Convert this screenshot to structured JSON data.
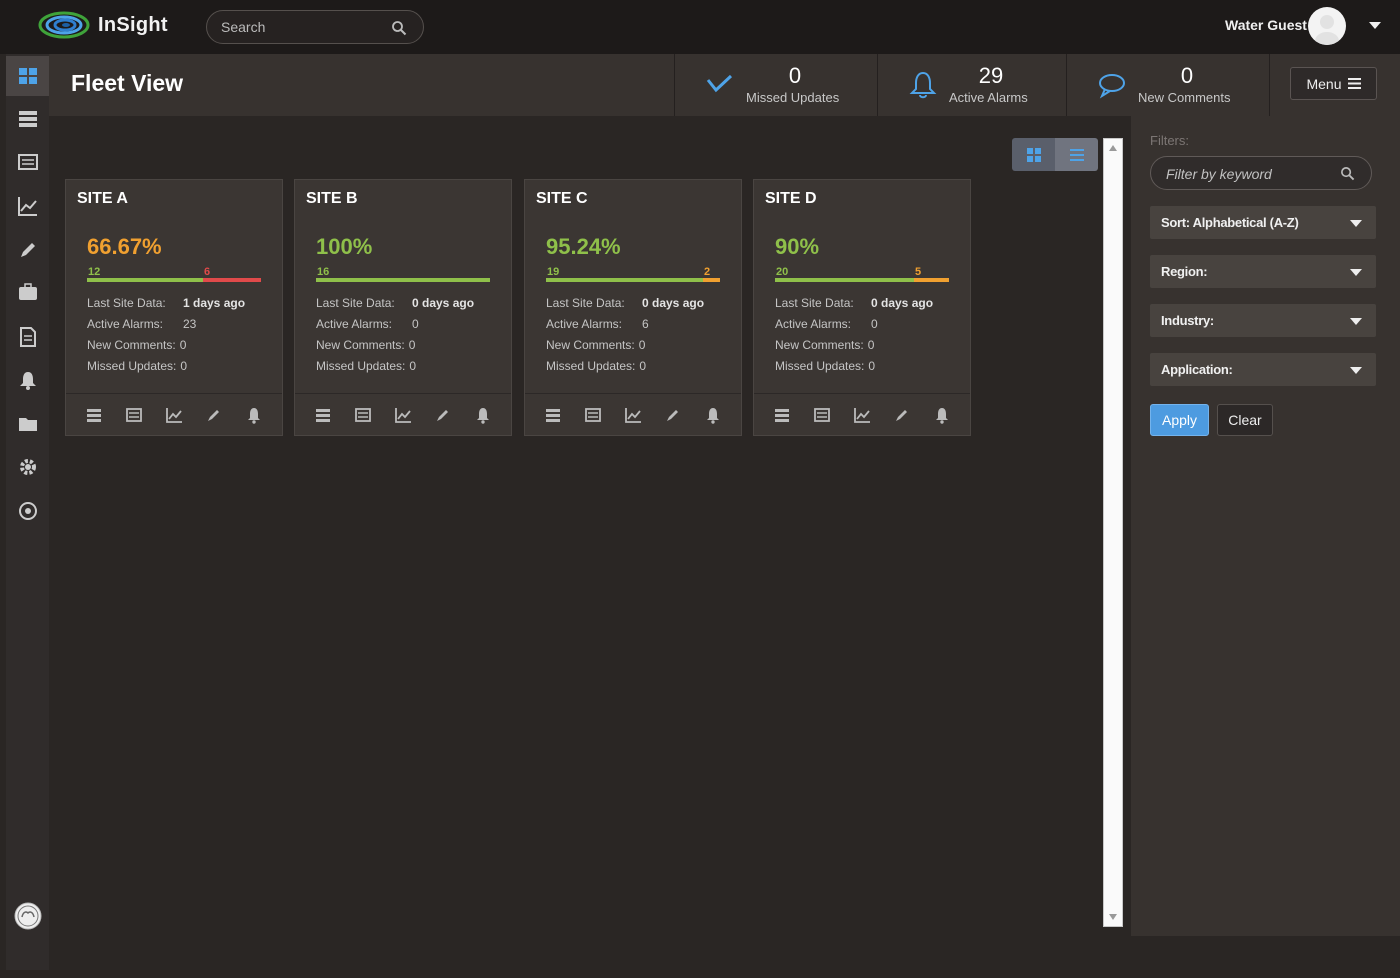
{
  "app": {
    "name": "InSight",
    "brand_color": "#4ea3e8"
  },
  "search": {
    "placeholder": "Search"
  },
  "user": {
    "name": "Water Guest"
  },
  "header": {
    "title": "Fleet View",
    "stats": [
      {
        "value": "0",
        "label": "Missed Updates",
        "icon": "checkmark-icon"
      },
      {
        "value": "29",
        "label": "Active Alarms",
        "icon": "bell-icon"
      },
      {
        "value": "0",
        "label": "New Comments",
        "icon": "speech-bubble-icon"
      }
    ],
    "menu_label": "Menu"
  },
  "sidebar": {
    "items": [
      "dashboard-icon",
      "servers-icon",
      "list-icon",
      "trend-icon",
      "pencil-icon",
      "briefcase-icon",
      "document-icon",
      "bell-icon",
      "folder-icon",
      "gear-icon",
      "target-icon"
    ]
  },
  "cards": [
    {
      "title": "SITE A",
      "percent": "66.67%",
      "percent_color": "#f0a030",
      "good": 12,
      "bad": 6,
      "bad_color": "#e04a4a",
      "fields": [
        {
          "label": "Last Site Data:",
          "value": "1 days ago"
        },
        {
          "label": "Active Alarms:",
          "value": "23"
        },
        {
          "label": "New Comments:",
          "value": "0"
        },
        {
          "label": "Missed Updates:",
          "value": "0"
        }
      ]
    },
    {
      "title": "SITE B",
      "percent": "100%",
      "percent_color": "#8fc04a",
      "good": 16,
      "bad": 0,
      "bad_color": "#f0a030",
      "fields": [
        {
          "label": "Last Site Data:",
          "value": "0 days ago"
        },
        {
          "label": "Active Alarms:",
          "value": "0"
        },
        {
          "label": "New Comments:",
          "value": "0"
        },
        {
          "label": "Missed Updates:",
          "value": "0"
        }
      ]
    },
    {
      "title": "SITE C",
      "percent": "95.24%",
      "percent_color": "#8fc04a",
      "good": 19,
      "bad": 2,
      "bad_color": "#f0a030",
      "fields": [
        {
          "label": "Last Site Data:",
          "value": "0 days ago"
        },
        {
          "label": "Active Alarms:",
          "value": "6"
        },
        {
          "label": "New Comments:",
          "value": "0"
        },
        {
          "label": "Missed Updates:",
          "value": "0"
        }
      ]
    },
    {
      "title": "SITE D",
      "percent": "90%",
      "percent_color": "#8fc04a",
      "good": 20,
      "bad": 5,
      "bad_color": "#f0a030",
      "fields": [
        {
          "label": "Last Site Data:",
          "value": "0 days ago"
        },
        {
          "label": "Active Alarms:",
          "value": "0"
        },
        {
          "label": "New Comments:",
          "value": "0"
        },
        {
          "label": "Missed Updates:",
          "value": "0"
        }
      ]
    }
  ],
  "filters": {
    "label": "Filters:",
    "keyword_placeholder": "Filter by keyword",
    "selects": [
      {
        "label": "Sort: Alphabetical (A-Z)"
      },
      {
        "label": "Region:"
      },
      {
        "label": "Industry:"
      },
      {
        "label": "Application:"
      }
    ],
    "apply_label": "Apply",
    "clear_label": "Clear"
  }
}
